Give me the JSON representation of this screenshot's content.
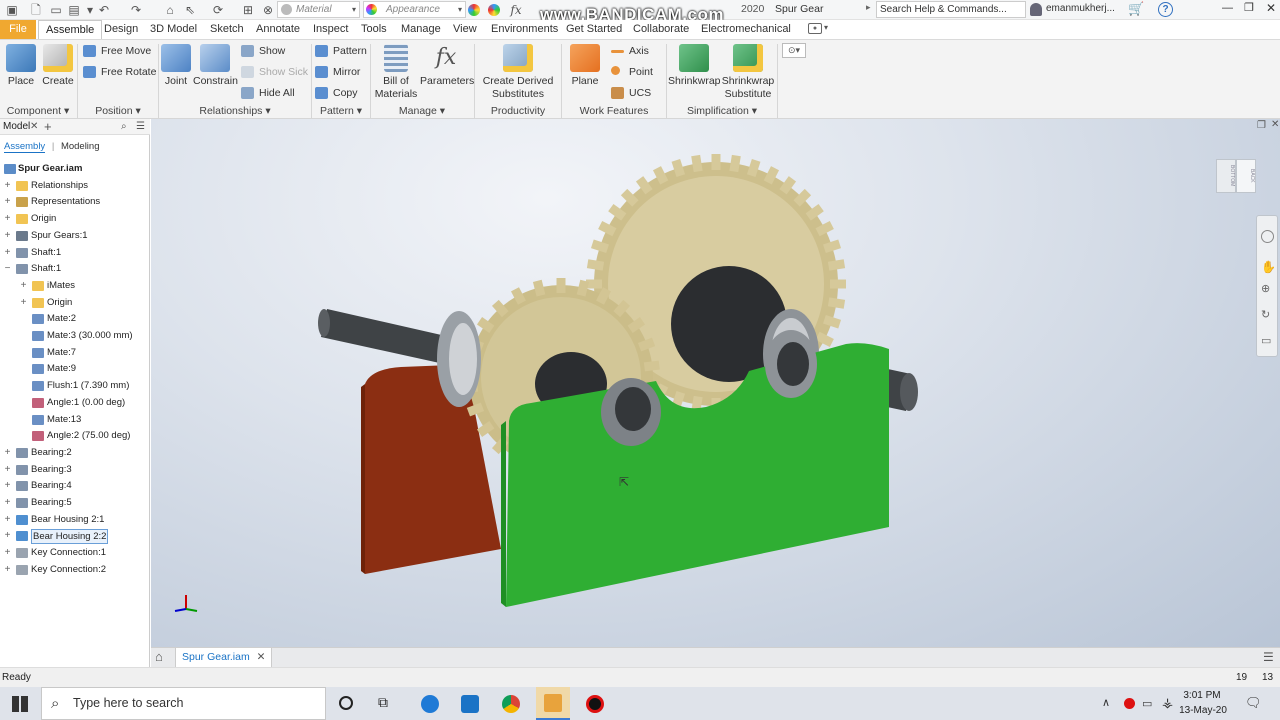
{
  "qat": {
    "material_label": "Material",
    "appearance_label": "Appearance",
    "fx_label": "fx",
    "title_fragment": "2020",
    "document_title": "Spur Gear",
    "search_placeholder": "Search Help & Commands...",
    "user_name": "emanmukherj...",
    "help_label": "?"
  },
  "watermark": "www.BANDICAM.com",
  "tabs": [
    "File",
    "Assemble",
    "Design",
    "3D Model",
    "Sketch",
    "Annotate",
    "Inspect",
    "Tools",
    "Manage",
    "View",
    "Environments",
    "Get Started",
    "Collaborate",
    "Electromechanical"
  ],
  "active_tab": "Assemble",
  "ribbon": {
    "component": {
      "place": "Place",
      "create": "Create",
      "label": "Component"
    },
    "position": {
      "free_move": "Free Move",
      "free_rotate": "Free Rotate",
      "label": "Position"
    },
    "relationships": {
      "joint": "Joint",
      "constrain": "Constrain",
      "show": "Show",
      "show_sick": "Show Sick",
      "hide_all": "Hide All",
      "label": "Relationships"
    },
    "pattern": {
      "pattern": "Pattern",
      "mirror": "Mirror",
      "copy": "Copy",
      "label": "Pattern"
    },
    "manage": {
      "bom_line1": "Bill of",
      "bom_line2": "Materials",
      "parameters": "Parameters",
      "label": "Manage"
    },
    "productivity": {
      "derived_line1": "Create Derived",
      "derived_line2": "Substitutes",
      "label": "Productivity"
    },
    "work_features": {
      "plane": "Plane",
      "axis": "Axis",
      "point": "Point",
      "ucs": "UCS",
      "label": "Work Features"
    },
    "simplification": {
      "shrinkwrap": "Shrinkwrap",
      "sw_sub_line1": "Shrinkwrap",
      "sw_sub_line2": "Substitute",
      "label": "Simplification"
    }
  },
  "browser": {
    "panel_title": "Model",
    "mode_assembly": "Assembly",
    "mode_modeling": "Modeling",
    "tree": [
      {
        "label": "Spur Gear.iam",
        "level": 0,
        "expand": "",
        "icon": "assembly-icon",
        "bold": true
      },
      {
        "label": "Relationships",
        "level": 0,
        "expand": "+",
        "icon": "folder-icon"
      },
      {
        "label": "Representations",
        "level": 0,
        "expand": "+",
        "icon": "representations-icon"
      },
      {
        "label": "Origin",
        "level": 0,
        "expand": "+",
        "icon": "folder-icon"
      },
      {
        "label": "Spur Gears:1",
        "level": 0,
        "expand": "+",
        "icon": "gear-component-icon"
      },
      {
        "label": "Shaft:1",
        "level": 0,
        "expand": "+",
        "icon": "component-icon"
      },
      {
        "label": "Shaft:1",
        "level": 0,
        "expand": "−",
        "icon": "component-icon"
      },
      {
        "label": "iMates",
        "level": 1,
        "expand": "+",
        "icon": "folder-icon"
      },
      {
        "label": "Origin",
        "level": 1,
        "expand": "+",
        "icon": "folder-icon"
      },
      {
        "label": "Mate:2",
        "level": 1,
        "expand": "",
        "icon": "mate-icon"
      },
      {
        "label": "Mate:3 (30.000 mm)",
        "level": 1,
        "expand": "",
        "icon": "mate-icon"
      },
      {
        "label": "Mate:7",
        "level": 1,
        "expand": "",
        "icon": "mate-icon"
      },
      {
        "label": "Mate:9",
        "level": 1,
        "expand": "",
        "icon": "mate-icon"
      },
      {
        "label": "Flush:1 (7.390 mm)",
        "level": 1,
        "expand": "",
        "icon": "flush-icon"
      },
      {
        "label": "Angle:1 (0.00 deg)",
        "level": 1,
        "expand": "",
        "icon": "angle-icon"
      },
      {
        "label": "Mate:13",
        "level": 1,
        "expand": "",
        "icon": "mate-icon"
      },
      {
        "label": "Angle:2 (75.00 deg)",
        "level": 1,
        "expand": "",
        "icon": "angle-icon"
      },
      {
        "label": "Bearing:2",
        "level": 0,
        "expand": "+",
        "icon": "component-icon"
      },
      {
        "label": "Bearing:3",
        "level": 0,
        "expand": "+",
        "icon": "component-icon"
      },
      {
        "label": "Bearing:4",
        "level": 0,
        "expand": "+",
        "icon": "component-icon"
      },
      {
        "label": "Bearing:5",
        "level": 0,
        "expand": "+",
        "icon": "component-icon"
      },
      {
        "label": "Bear Housing 2:1",
        "level": 0,
        "expand": "+",
        "icon": "part-icon"
      },
      {
        "label": "Bear Housing 2:2",
        "level": 0,
        "expand": "+",
        "icon": "part-icon",
        "selected": true
      },
      {
        "label": "Key Connection:1",
        "level": 0,
        "expand": "+",
        "icon": "connection-icon"
      },
      {
        "label": "Key Connection:2",
        "level": 0,
        "expand": "+",
        "icon": "connection-icon"
      }
    ]
  },
  "viewcube": {
    "face_left": "BOTTOM",
    "face_right": "BACK"
  },
  "doc_tab": "Spur Gear.iam",
  "status": {
    "text": "Ready",
    "count_a": "19",
    "count_b": "13"
  },
  "taskbar": {
    "search_placeholder": "Type here to search",
    "time": "3:01 PM",
    "date": "13-May-20"
  },
  "colors": {
    "file_tab": "#f0a830",
    "housing_green": "#2fae33",
    "housing_red": "#8b2e12",
    "gear": "#d2c595",
    "shaft": "#444444"
  }
}
